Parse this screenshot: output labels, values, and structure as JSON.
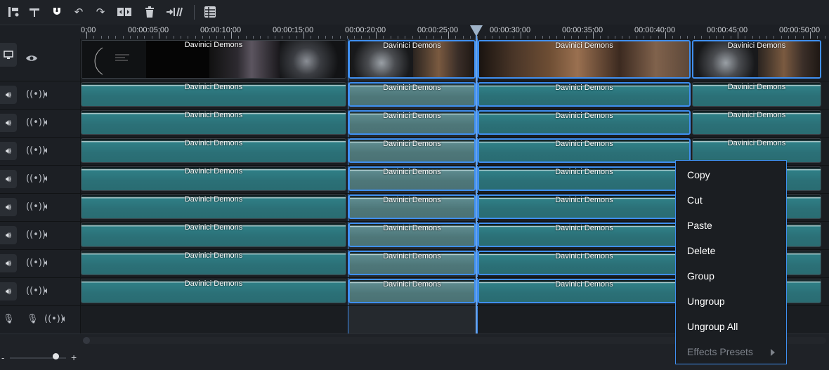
{
  "toolbar": {
    "icons": [
      "split-marker-icon",
      "trim-icon",
      "magnet-icon",
      "undo-icon",
      "redo-icon",
      "split-icon",
      "trash-icon",
      "ripple-icon",
      "table-icon"
    ]
  },
  "ruler": {
    "ticks": [
      "0;00",
      "00:00:05;00",
      "00:00:10;00",
      "00:00:15;00",
      "00:00:20;00",
      "00:00:25;00",
      "00:00:30;00",
      "00:00:35;00",
      "00:00:40;00",
      "00:00:45;00",
      "00:00:50;00"
    ]
  },
  "tracks": {
    "clip_title": "Davinici Demons"
  },
  "context_menu": {
    "items": [
      "Copy",
      "Cut",
      "Paste",
      "Delete",
      "Group",
      "Ungroup",
      "Ungroup All"
    ],
    "submenu": "Effects Presets"
  },
  "zoom": {
    "minus": "-",
    "plus": "+"
  },
  "colors": {
    "accent": "#3f8ff0",
    "audio_clip": "#2b7077",
    "background": "#1c1f24"
  }
}
